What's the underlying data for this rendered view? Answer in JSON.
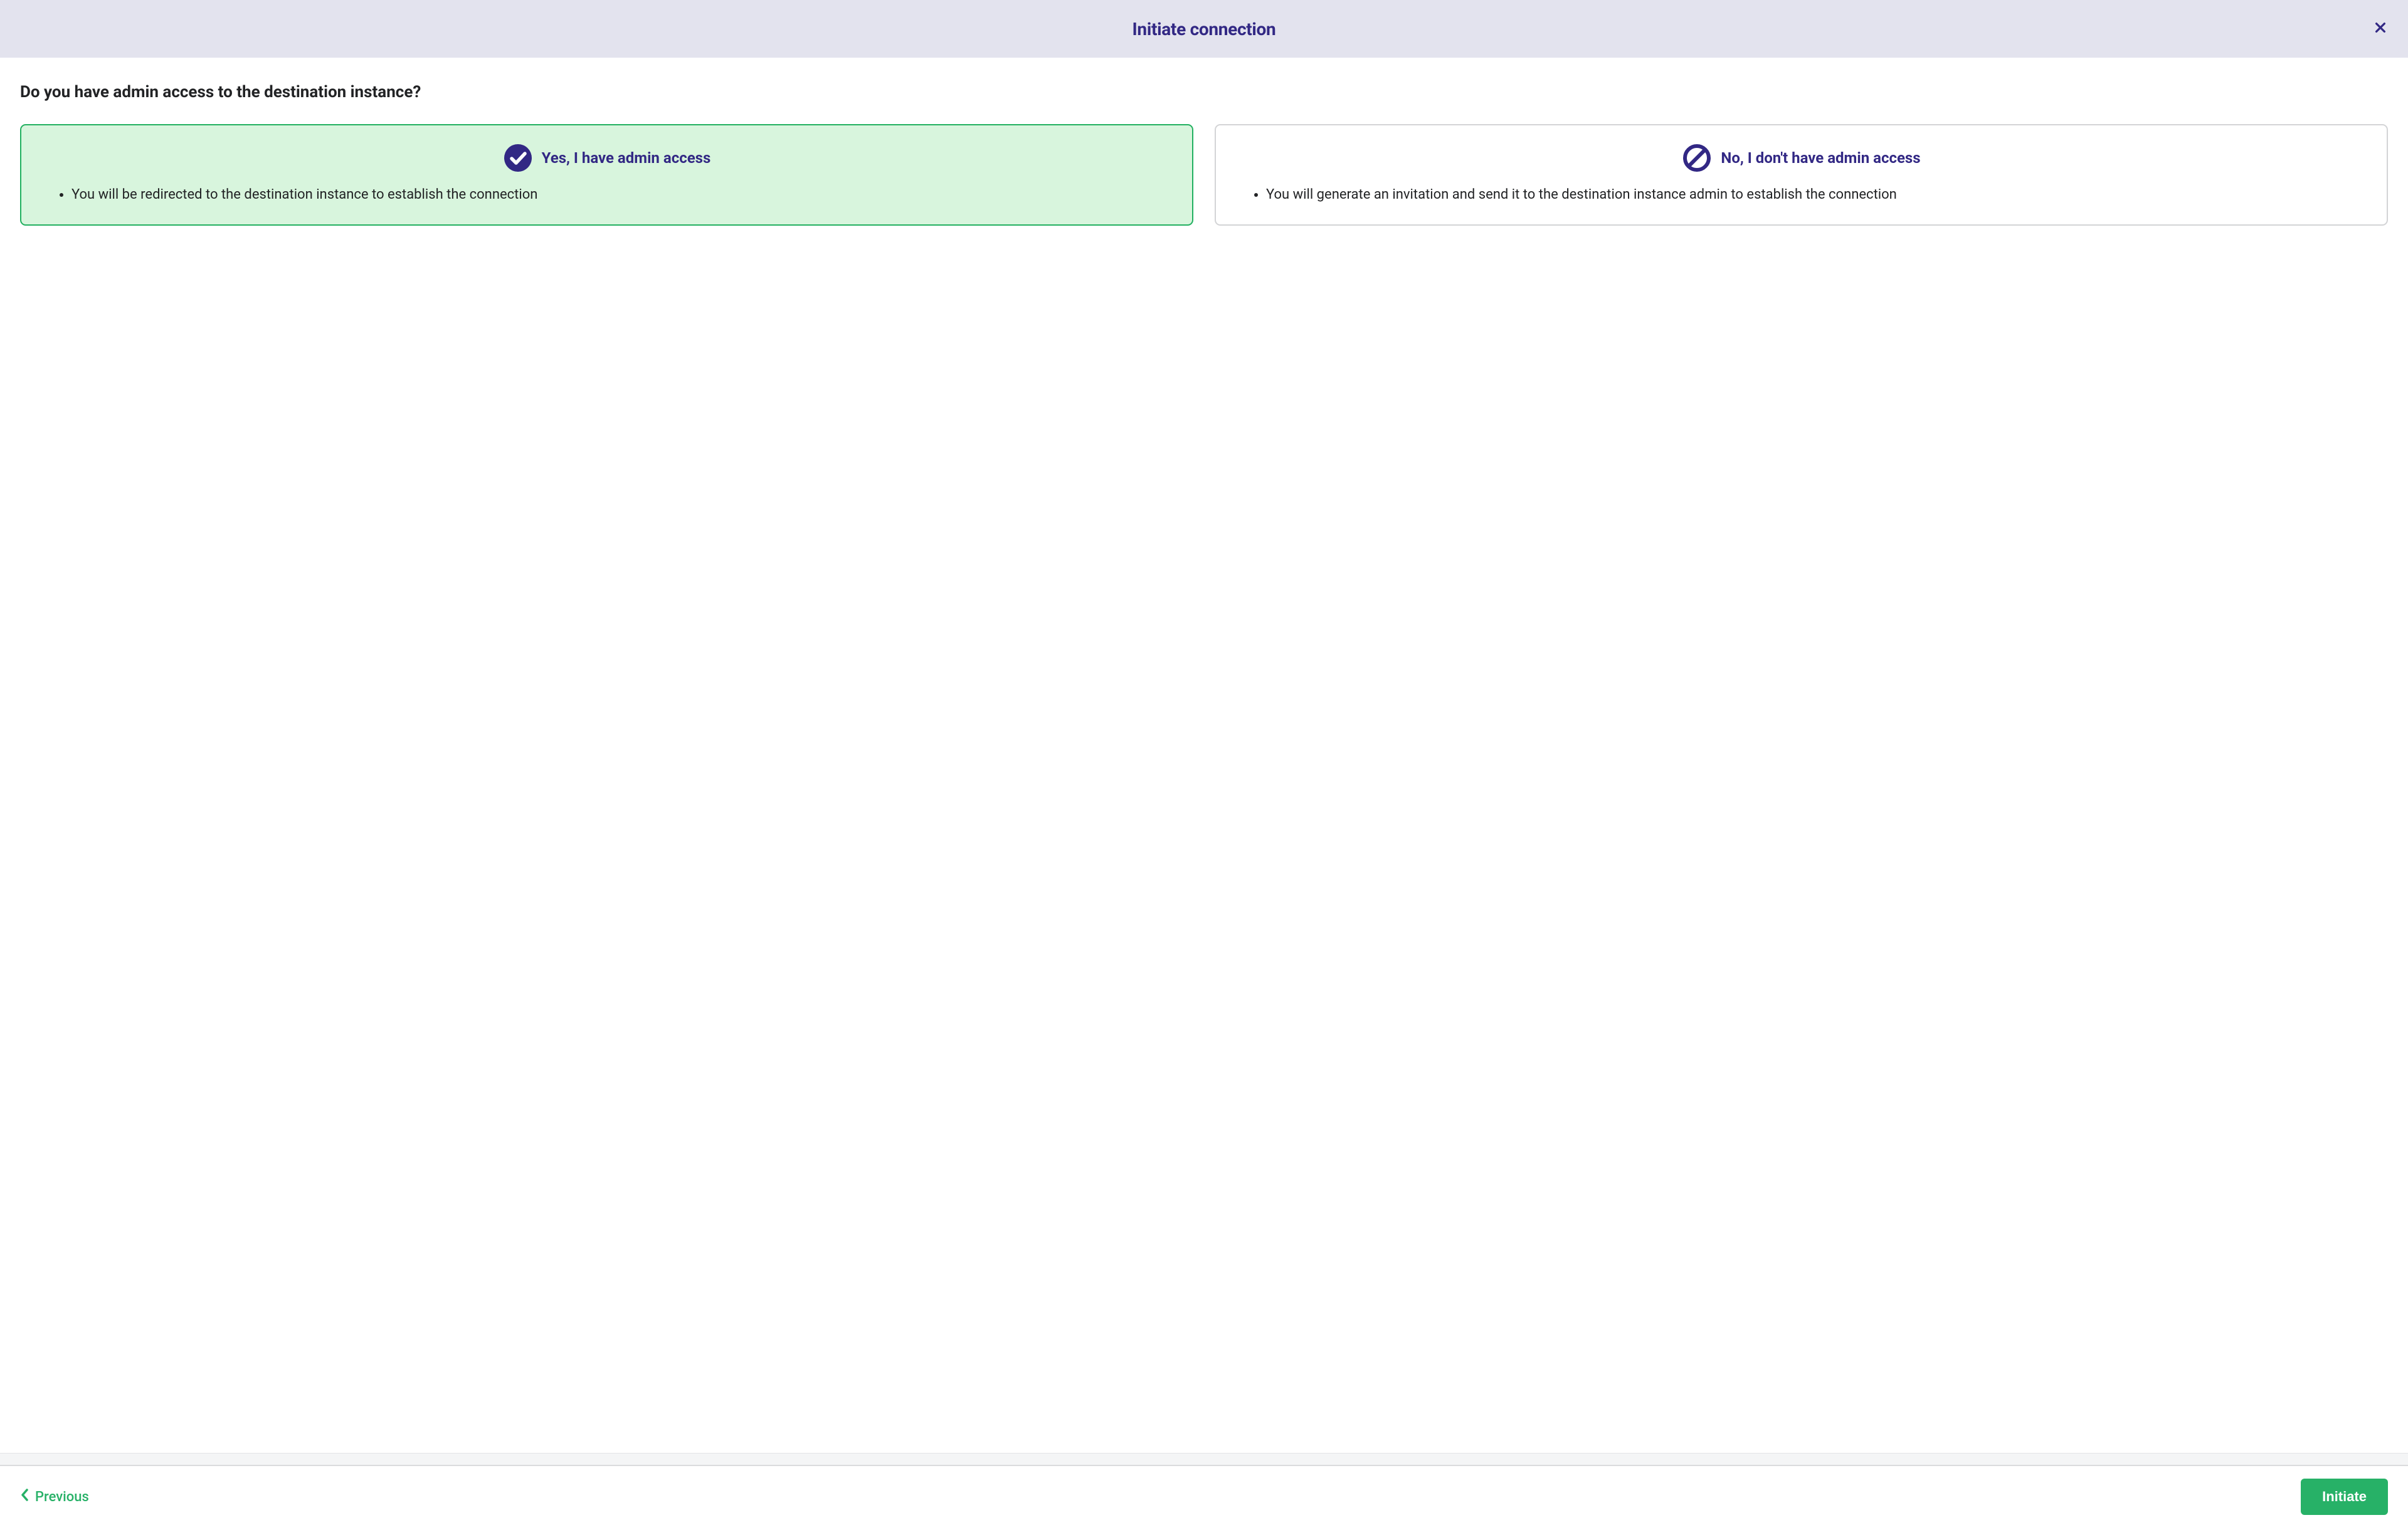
{
  "header": {
    "title": "Initiate connection"
  },
  "main": {
    "question": "Do you have admin access to the destination instance?",
    "options": {
      "yes": {
        "title": "Yes, I have admin access",
        "bullet": "You will be redirected to the destination instance to establish the connection"
      },
      "no": {
        "title": "No, I don't have admin access",
        "bullet": "You will generate an invitation and send it to the destination instance admin to establish the connection"
      }
    }
  },
  "footer": {
    "previous": "Previous",
    "initiate": "Initiate"
  }
}
